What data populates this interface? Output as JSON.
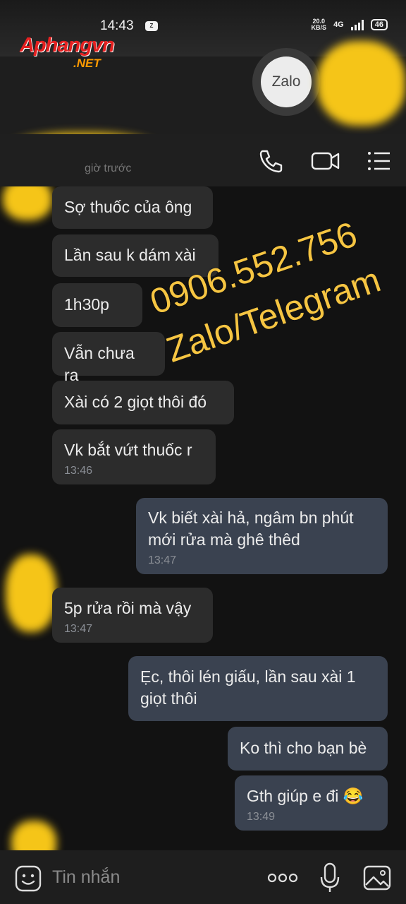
{
  "status": {
    "time": "14:43",
    "speed_top": "20.0",
    "speed_unit": "KB/S",
    "network": "4G",
    "battery": "46"
  },
  "watermark_logo": {
    "brand": "Aphangvn",
    "tld": ".NET"
  },
  "zalo_button": {
    "label": "Zalo"
  },
  "header": {
    "subtitle": "giờ trước"
  },
  "messages": [
    {
      "text": "Sợ thuốc của ông",
      "time": ""
    },
    {
      "text": "Lần sau k dám xài",
      "time": ""
    },
    {
      "text": "1h30p",
      "time": ""
    },
    {
      "text": "Vẫn chưa ra",
      "time": ""
    },
    {
      "text": "Xài có 2 giọt thôi đó",
      "time": ""
    },
    {
      "text": "Vk bắt vứt thuốc r",
      "time": "13:46"
    },
    {
      "line1": "Vk biết xài hả, ngâm bn phút",
      "line2": "mới rửa mà ghê thêd",
      "time": "13:47"
    },
    {
      "text": "5p rửa rồi mà vậy",
      "time": "13:47"
    },
    {
      "line1": "Ẹc, thôi lén giấu, lần sau xài 1",
      "line2": "giọt thôi",
      "time": ""
    },
    {
      "text": "Ko thì cho bạn bè",
      "time": ""
    },
    {
      "text": "Gth giúp e đi 😂",
      "time": "13:49"
    }
  ],
  "overlay": {
    "phone": "0906.552.756",
    "apps": "Zalo/Telegram"
  },
  "input": {
    "placeholder": "Tin nhắn"
  },
  "colors": {
    "incoming": "#2c2c2c",
    "outgoing": "#3a4250",
    "overlay_text": "#f6c542",
    "background": "#121212"
  }
}
